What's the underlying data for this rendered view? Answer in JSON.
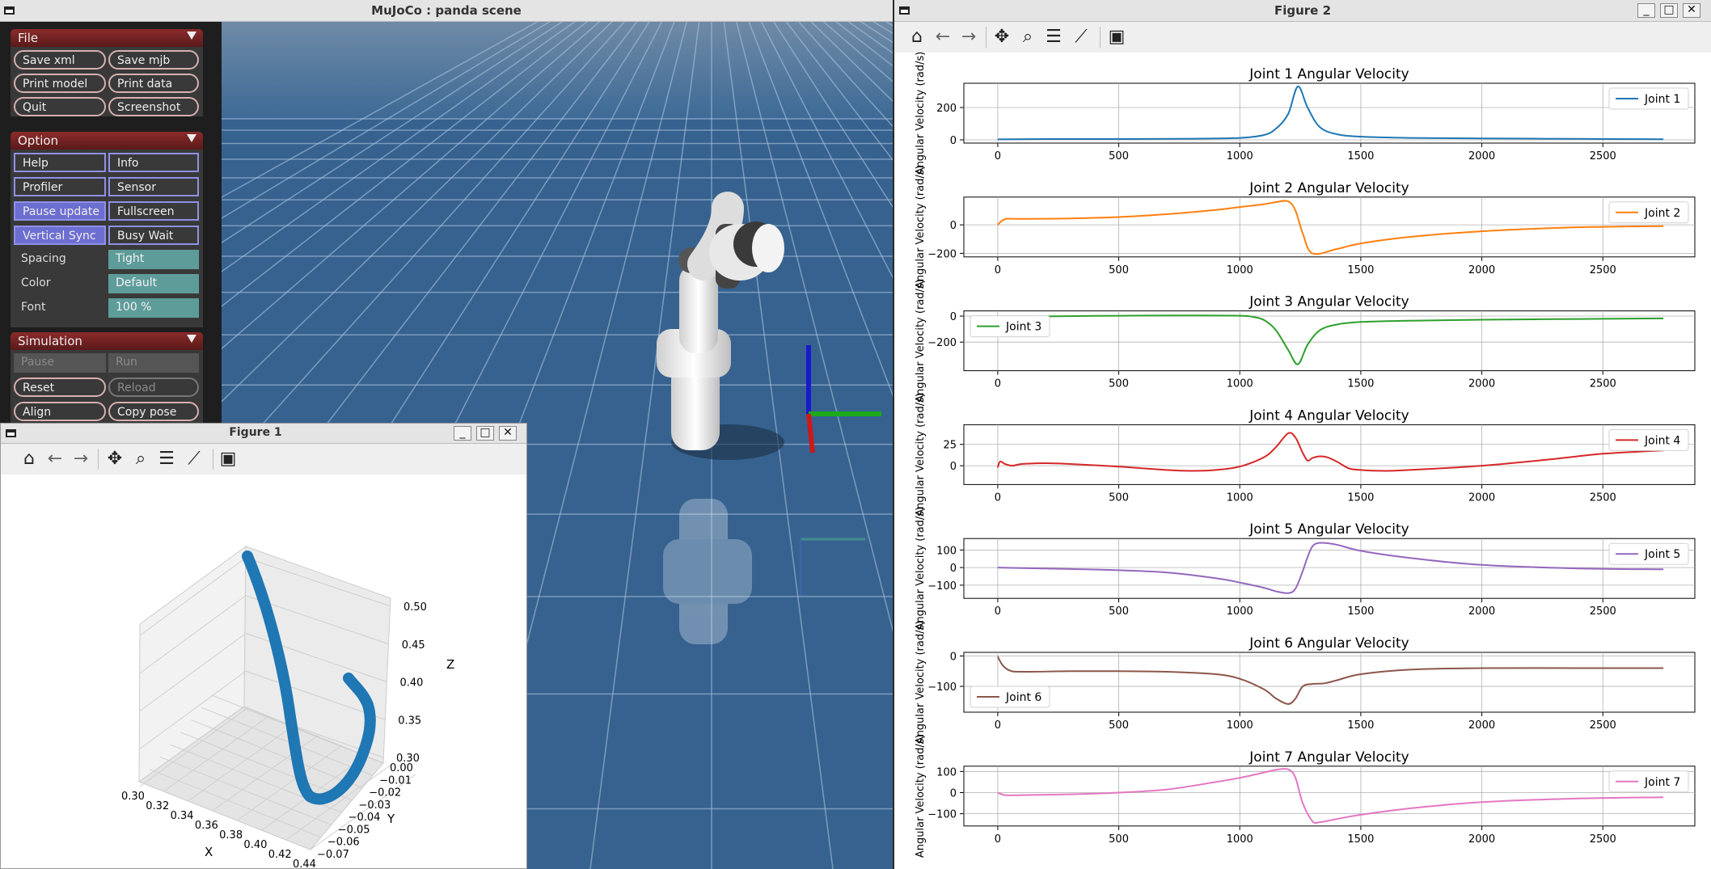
{
  "mujoco": {
    "title": "MuJoCo : panda scene",
    "file": {
      "header": "File",
      "buttons": [
        "Save xml",
        "Save mjb",
        "Print model",
        "Print data",
        "Quit",
        "Screenshot"
      ]
    },
    "option": {
      "header": "Option",
      "buttons": [
        "Help",
        "Info",
        "Profiler",
        "Sensor",
        "Pause update",
        "Fullscreen",
        "Vertical Sync",
        "Busy Wait"
      ],
      "spacing_label": "Spacing",
      "spacing_value": "Tight",
      "color_label": "Color",
      "color_value": "Default",
      "font_label": "Font",
      "font_value": "100 %"
    },
    "simulation": {
      "header": "Simulation",
      "buttons": [
        "Pause",
        "Run",
        "Reset",
        "Reload",
        "Align",
        "Copy pose"
      ]
    }
  },
  "figure1": {
    "title": "Figure 1",
    "toolbar_icons": [
      "home-icon",
      "back-icon",
      "forward-icon",
      "pan-icon",
      "zoom-icon",
      "configure-icon",
      "edit-axes-icon",
      "save-icon"
    ],
    "axes": {
      "xlabel": "X",
      "ylabel": "Y",
      "zlabel": "Z",
      "xticks": [
        "0.30",
        "0.32",
        "0.34",
        "0.36",
        "0.38",
        "0.40",
        "0.42",
        "0.44"
      ],
      "yticks": [
        "0.00",
        "−0.01",
        "−0.02",
        "−0.03",
        "−0.04",
        "−0.05",
        "−0.06",
        "−0.07"
      ],
      "zticks": [
        "0.50",
        "0.45",
        "0.40",
        "0.35",
        "0.30"
      ]
    },
    "line_color": "#1f77b4"
  },
  "figure2": {
    "title": "Figure 2",
    "toolbar_icons": [
      "home-icon",
      "back-icon",
      "forward-icon",
      "pan-icon",
      "zoom-icon",
      "configure-icon",
      "edit-axes-icon",
      "save-icon"
    ],
    "ylabel": "Angular Velocity (rad/s)",
    "xticks": [
      "0",
      "500",
      "1000",
      "1500",
      "2000",
      "2500"
    ]
  },
  "chart_data": [
    {
      "type": "line",
      "title": "Joint 1 Angular Velocity",
      "ylabel": "Angular Velocity (rad/s)",
      "color": "#1f77b4",
      "legend": "Joint 1",
      "legend_loc": "upper right",
      "xlim": [
        -140,
        2880
      ],
      "ylim": [
        -20,
        350
      ],
      "yticks": [
        "0",
        "200"
      ],
      "ytick_values": [
        0,
        200
      ],
      "x": [
        0,
        200,
        500,
        800,
        1000,
        1100,
        1150,
        1200,
        1240,
        1280,
        1330,
        1400,
        1500,
        1700,
        2000,
        2400,
        2750
      ],
      "y": [
        3,
        5,
        5,
        7,
        12,
        30,
        70,
        160,
        330,
        200,
        80,
        35,
        20,
        12,
        9,
        6,
        4
      ]
    },
    {
      "type": "line",
      "title": "Joint 2 Angular Velocity",
      "ylabel": "Angular Velocity (rad/s)",
      "color": "#ff7f0e",
      "legend": "Joint 2",
      "legend_loc": "upper right",
      "xlim": [
        -140,
        2880
      ],
      "ylim": [
        -225,
        195
      ],
      "yticks": [
        "0",
        "−200"
      ],
      "ytick_values": [
        0,
        -200
      ],
      "x": [
        0,
        30,
        100,
        300,
        500,
        700,
        900,
        1000,
        1100,
        1150,
        1200,
        1230,
        1260,
        1300,
        1400,
        1500,
        1700,
        2000,
        2300,
        2500,
        2750
      ],
      "y": [
        0,
        40,
        42,
        45,
        55,
        75,
        105,
        125,
        145,
        160,
        165,
        100,
        -60,
        -200,
        -170,
        -130,
        -85,
        -45,
        -22,
        -14,
        -9
      ]
    },
    {
      "type": "line",
      "title": "Joint 3 Angular Velocity",
      "ylabel": "Angular Velocity (rad/s)",
      "color": "#2ca02c",
      "legend": "Joint 3",
      "legend_loc": "upper left",
      "xlim": [
        -140,
        2880
      ],
      "ylim": [
        -420,
        40
      ],
      "yticks": [
        "0",
        "−200"
      ],
      "ytick_values": [
        0,
        -200
      ],
      "x": [
        0,
        200,
        500,
        800,
        1000,
        1050,
        1100,
        1150,
        1200,
        1240,
        1280,
        1330,
        1400,
        1500,
        1700,
        2000,
        2400,
        2750
      ],
      "y": [
        -5,
        -2,
        3,
        5,
        3,
        -5,
        -30,
        -110,
        -260,
        -370,
        -220,
        -110,
        -65,
        -45,
        -35,
        -28,
        -22,
        -18
      ]
    },
    {
      "type": "line",
      "title": "Joint 4 Angular Velocity",
      "ylabel": "Angular Velocity (rad/s)",
      "color": "#d62728",
      "legend": "Joint 4",
      "legend_loc": "upper right",
      "xlim": [
        -140,
        2880
      ],
      "ylim": [
        -22,
        48
      ],
      "yticks": [
        "25",
        "0"
      ],
      "ytick_values": [
        25,
        0
      ],
      "x": [
        0,
        10,
        30,
        60,
        100,
        200,
        300,
        500,
        700,
        800,
        900,
        1000,
        1100,
        1150,
        1200,
        1230,
        1260,
        1280,
        1300,
        1330,
        1360,
        1400,
        1450,
        1500,
        1600,
        1700,
        2000,
        2300,
        2500,
        2750
      ],
      "y": [
        -2,
        5,
        2,
        0,
        2,
        3,
        2,
        -1,
        -5,
        -6,
        -5,
        -1,
        10,
        22,
        38,
        33,
        15,
        6,
        9,
        11,
        10,
        5,
        -3,
        -5,
        -6,
        -5,
        0,
        8,
        14,
        18
      ]
    },
    {
      "type": "line",
      "title": "Joint 5 Angular Velocity",
      "ylabel": "Angular Velocity (rad/s)",
      "color": "#9467bd",
      "legend": "Joint 5",
      "legend_loc": "upper right",
      "xlim": [
        -140,
        2880
      ],
      "ylim": [
        -175,
        165
      ],
      "yticks": [
        "100",
        "0",
        "−100"
      ],
      "ytick_values": [
        100,
        0,
        -100
      ],
      "x": [
        0,
        100,
        300,
        500,
        700,
        900,
        1000,
        1100,
        1150,
        1200,
        1230,
        1260,
        1280,
        1300,
        1330,
        1400,
        1500,
        1700,
        2000,
        2400,
        2750
      ],
      "y": [
        0,
        -3,
        -8,
        -15,
        -28,
        -60,
        -85,
        -115,
        -135,
        -145,
        -120,
        -20,
        60,
        120,
        140,
        130,
        95,
        55,
        15,
        -5,
        -10
      ]
    },
    {
      "type": "line",
      "title": "Joint 6 Angular Velocity",
      "ylabel": "Angular Velocity (rad/s)",
      "color": "#8c564b",
      "legend": "Joint 6",
      "legend_loc": "lower left",
      "xlim": [
        -140,
        2880
      ],
      "ylim": [
        -185,
        12
      ],
      "yticks": [
        "0",
        "−100"
      ],
      "ytick_values": [
        0,
        -100
      ],
      "x": [
        0,
        20,
        50,
        100,
        300,
        500,
        700,
        900,
        1000,
        1100,
        1150,
        1200,
        1230,
        1260,
        1300,
        1350,
        1400,
        1500,
        1700,
        2000,
        2400,
        2750
      ],
      "y": [
        -2,
        -30,
        -48,
        -52,
        -50,
        -50,
        -52,
        -60,
        -75,
        -110,
        -140,
        -158,
        -140,
        -100,
        -92,
        -90,
        -80,
        -60,
        -45,
        -40,
        -40,
        -40
      ]
    },
    {
      "type": "line",
      "title": "Joint 7 Angular Velocity",
      "ylabel": "Angular Velocity (rad/s)",
      "color": "#e377c2",
      "legend": "Joint 7",
      "legend_loc": "upper right",
      "xlim": [
        -140,
        2880
      ],
      "ylim": [
        -158,
        125
      ],
      "yticks": [
        "100",
        "0",
        "−100"
      ],
      "ytick_values": [
        100,
        0,
        -100
      ],
      "x": [
        0,
        30,
        100,
        300,
        500,
        700,
        900,
        1000,
        1100,
        1150,
        1200,
        1230,
        1260,
        1300,
        1330,
        1400,
        1500,
        1700,
        2000,
        2400,
        2750
      ],
      "y": [
        0,
        -12,
        -12,
        -8,
        0,
        15,
        50,
        70,
        95,
        108,
        110,
        70,
        -50,
        -135,
        -140,
        -125,
        -105,
        -75,
        -45,
        -28,
        -22
      ]
    }
  ]
}
